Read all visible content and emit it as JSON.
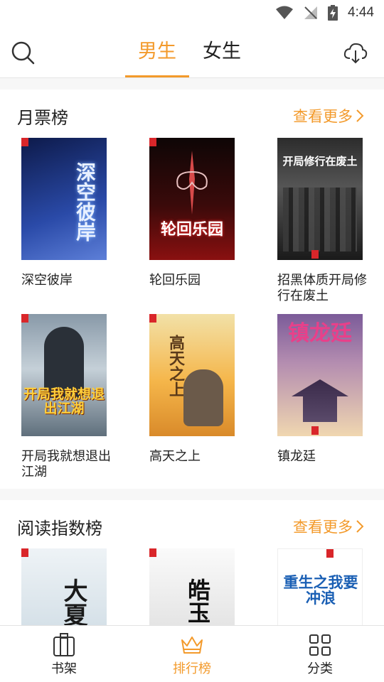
{
  "status_bar": {
    "time": "4:44"
  },
  "header": {
    "tabs": [
      {
        "label": "男生",
        "active": true
      },
      {
        "label": "女生",
        "active": false
      }
    ],
    "accent_color": "#f39a2b"
  },
  "sections": [
    {
      "title": "月票榜",
      "more_label": "查看更多",
      "books": [
        {
          "title": "深空彼岸",
          "cover_text": "深空彼岸",
          "cover_colors": [
            "#0d1a4a",
            "#3b5cc2"
          ]
        },
        {
          "title": "轮回乐园",
          "cover_text": "轮回乐园",
          "cover_colors": [
            "#1a0a0a",
            "#8a1010"
          ]
        },
        {
          "title": "招黑体质开局修行在废土",
          "cover_text": "开局修行在废土",
          "cover_colors": [
            "#1c1c1c",
            "#6a6a6a"
          ]
        },
        {
          "title": "开局我就想退出江湖",
          "cover_text": "开局我就想退出江湖",
          "cover_colors": [
            "#5a6a7a",
            "#c9d3da"
          ]
        },
        {
          "title": "高天之上",
          "cover_text": "高天之上",
          "cover_colors": [
            "#f6b84a",
            "#f2e0a6"
          ]
        },
        {
          "title": "镇龙廷",
          "cover_text": "镇龙廷",
          "cover_colors": [
            "#6e4f8c",
            "#e9c79a"
          ]
        }
      ]
    },
    {
      "title": "阅读指数榜",
      "more_label": "查看更多",
      "books": [
        {
          "title": "",
          "cover_text": "大夏",
          "cover_colors": [
            "#dfe8ee",
            "#9fb3c2"
          ]
        },
        {
          "title": "",
          "cover_text": "皓玉",
          "cover_colors": [
            "#f3f3f3",
            "#b8b8b8"
          ]
        },
        {
          "title": "",
          "cover_text": "重生之我要冲浪",
          "cover_colors": [
            "#ffffff",
            "#d9eef8"
          ]
        }
      ]
    }
  ],
  "bottom_nav": [
    {
      "label": "书架",
      "icon": "bookshelf-icon",
      "active": false
    },
    {
      "label": "排行榜",
      "icon": "crown-icon",
      "active": true
    },
    {
      "label": "分类",
      "icon": "grid-icon",
      "active": false
    }
  ]
}
